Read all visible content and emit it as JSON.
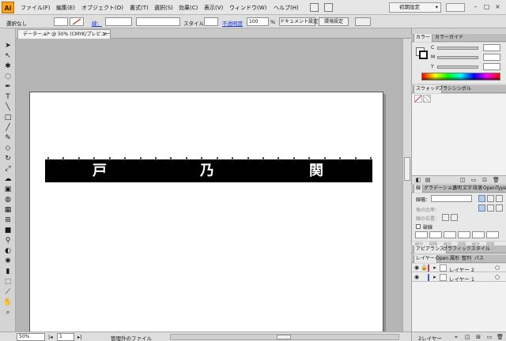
{
  "app": {
    "logo": "Ai"
  },
  "menu": [
    "ファイル(F)",
    "編集(E)",
    "オブジェクト(O)",
    "書式(T)",
    "選択(S)",
    "効果(C)",
    "表示(V)",
    "ウィンドウ(W)",
    "ヘルプ(H)"
  ],
  "workspace": {
    "label": "初期設定"
  },
  "control": {
    "selection_label": "選択なし",
    "stroke_label": "線：",
    "style_label": "スタイル：",
    "opacity_label": "不透明度",
    "opacity_value": "100",
    "opacity_unit": "%",
    "document_setup": "ドキュメント設定",
    "preferences": "環境設定"
  },
  "document_tab": {
    "title": "データー.ai* @ 50% (CMYK/プレビュー)",
    "close": "×"
  },
  "banner": {
    "chars": [
      "戸",
      "乃",
      "関"
    ]
  },
  "status": {
    "zoom": "50%",
    "page": "1",
    "info": "管理外のファイル"
  },
  "panels": {
    "color_tabs": [
      "カラー",
      "カラーガイド"
    ],
    "color_channels": [
      "C",
      "M",
      "Y",
      "K"
    ],
    "swatch_tabs": [
      "スウォッチ",
      "ブラシ",
      "シンボル"
    ],
    "stroke_tabs": [
      "線",
      "グラデーション",
      "透明",
      "文字",
      "段落",
      "OpenType"
    ],
    "stroke": {
      "weight_label": "線幅：",
      "miter_label": "角の比率：",
      "cap_label": "線の位置：",
      "dashed_label": "破線",
      "dash_fields": [
        "線分",
        "間隔",
        "線分",
        "間隔",
        "線分",
        "間隔"
      ]
    },
    "appearance_tabs": [
      "アピアランス",
      "グラフィックスタイル"
    ],
    "layers_tabs": [
      "レイヤー",
      "Open",
      "属形",
      "整列",
      "パス"
    ],
    "layers": [
      {
        "name": "レイヤー 2",
        "color": "#d8324a"
      },
      {
        "name": "レイヤー 1",
        "color": "#3b5ed9"
      }
    ],
    "layers_footer": "2レイヤー"
  },
  "colors": {
    "accent": "#f9a21a",
    "banner": "#000000"
  }
}
